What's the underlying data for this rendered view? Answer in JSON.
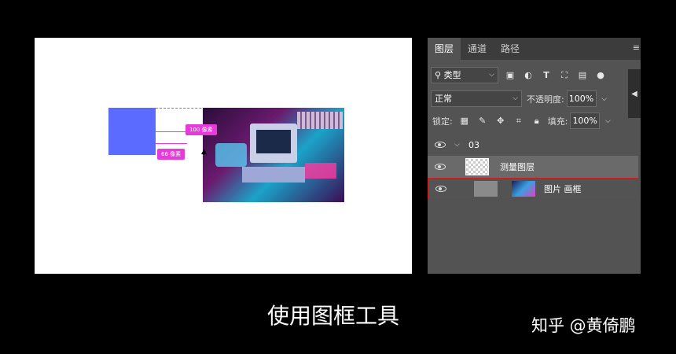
{
  "canvas": {
    "measure_horizontal": "100 像素",
    "measure_vertical": "66 像素"
  },
  "panel": {
    "tabs": [
      "图层",
      "通道",
      "路径"
    ],
    "menu_icon": "≡",
    "filter": {
      "label": "类型",
      "icons": [
        "image-filter-icon",
        "adjustment-filter-icon",
        "type-filter-icon",
        "shape-filter-icon",
        "smart-object-filter-icon"
      ]
    },
    "blend_mode": "正常",
    "opacity_label": "不透明度:",
    "opacity_value": "100%",
    "lock_label": "锁定:",
    "lock_icons": [
      "lock-transparent-icon",
      "lock-image-icon",
      "lock-position-icon",
      "lock-artboard-icon",
      "lock-all-icon"
    ],
    "fill_label": "填充:",
    "fill_value": "100%",
    "layers": [
      {
        "name": "03",
        "type": "group",
        "visible": true,
        "expanded": true
      },
      {
        "name": "测量图层",
        "type": "layer",
        "visible": true,
        "selected": true
      },
      {
        "name": "图片 画框",
        "type": "frame",
        "visible": true,
        "highlighted": true
      }
    ]
  },
  "caption": "使用图框工具",
  "watermark": "知乎 @黄倚鹏",
  "colors": {
    "accent_magenta": "#e63bd8",
    "blue_rect": "#5c6bff",
    "panel_bg": "#535353",
    "highlight_red": "#c81e1e"
  }
}
